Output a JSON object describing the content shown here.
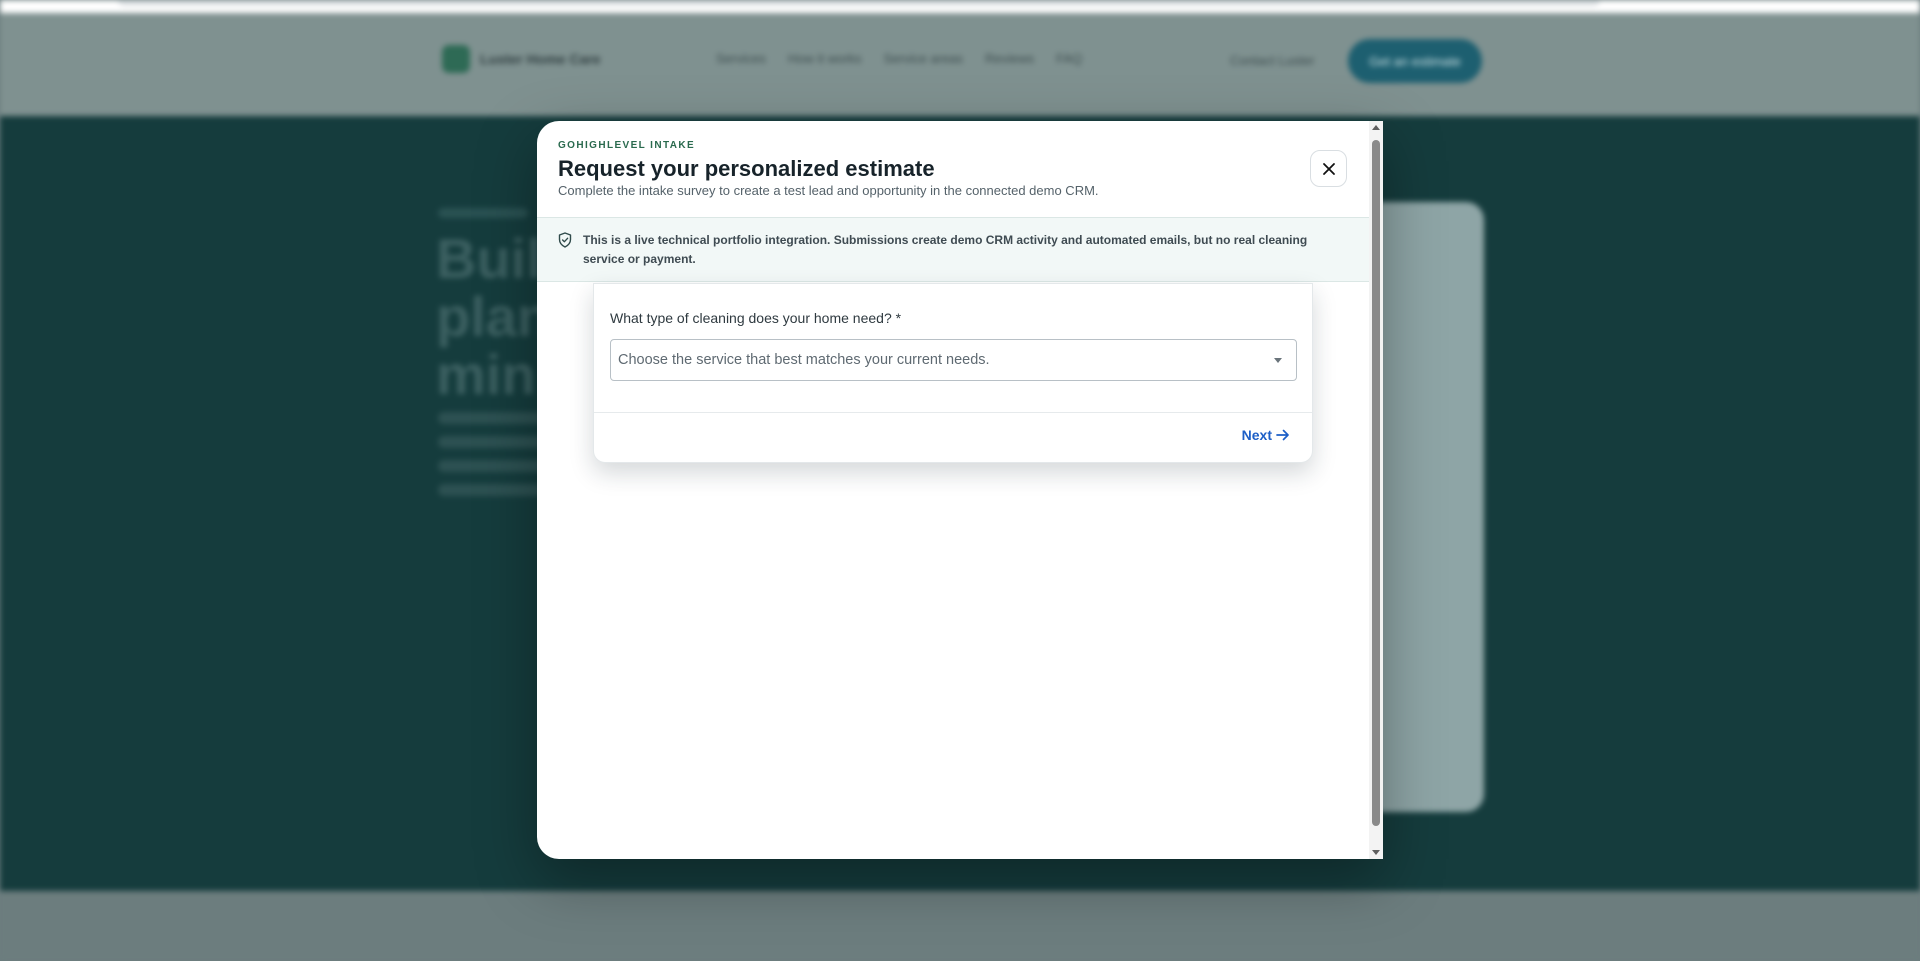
{
  "background": {
    "brand_name": "Luster Home Care",
    "nav_items": [
      "Services",
      "How it works",
      "Service areas",
      "Reviews",
      "FAQ"
    ],
    "contact_label": "Contact Luster",
    "cta_label": "Get an estimate",
    "hero_title_fragments": [
      "Buil",
      "plan",
      "min"
    ]
  },
  "modal": {
    "eyebrow": "GOHIGHLEVEL INTAKE",
    "title": "Request your personalized estimate",
    "subtitle": "Complete the intake survey to create a test lead and opportunity in the connected demo CRM.",
    "close_icon": "close-icon",
    "notice": {
      "icon": "shield-check-icon",
      "text": "This is a live technical portfolio integration. Submissions create demo CRM activity and automated emails, but no real cleaning service or payment."
    },
    "form": {
      "question_label": "What type of cleaning does your home need? *",
      "select_placeholder": "Choose the service that best matches your current needs.",
      "select_icon": "chevron-down-icon",
      "next_label": "Next",
      "next_icon": "arrow-right-icon"
    }
  },
  "colors": {
    "accent": "#1d5fc7",
    "eyebrow": "#2a6a4e",
    "hero_bg": "#153c3d"
  }
}
